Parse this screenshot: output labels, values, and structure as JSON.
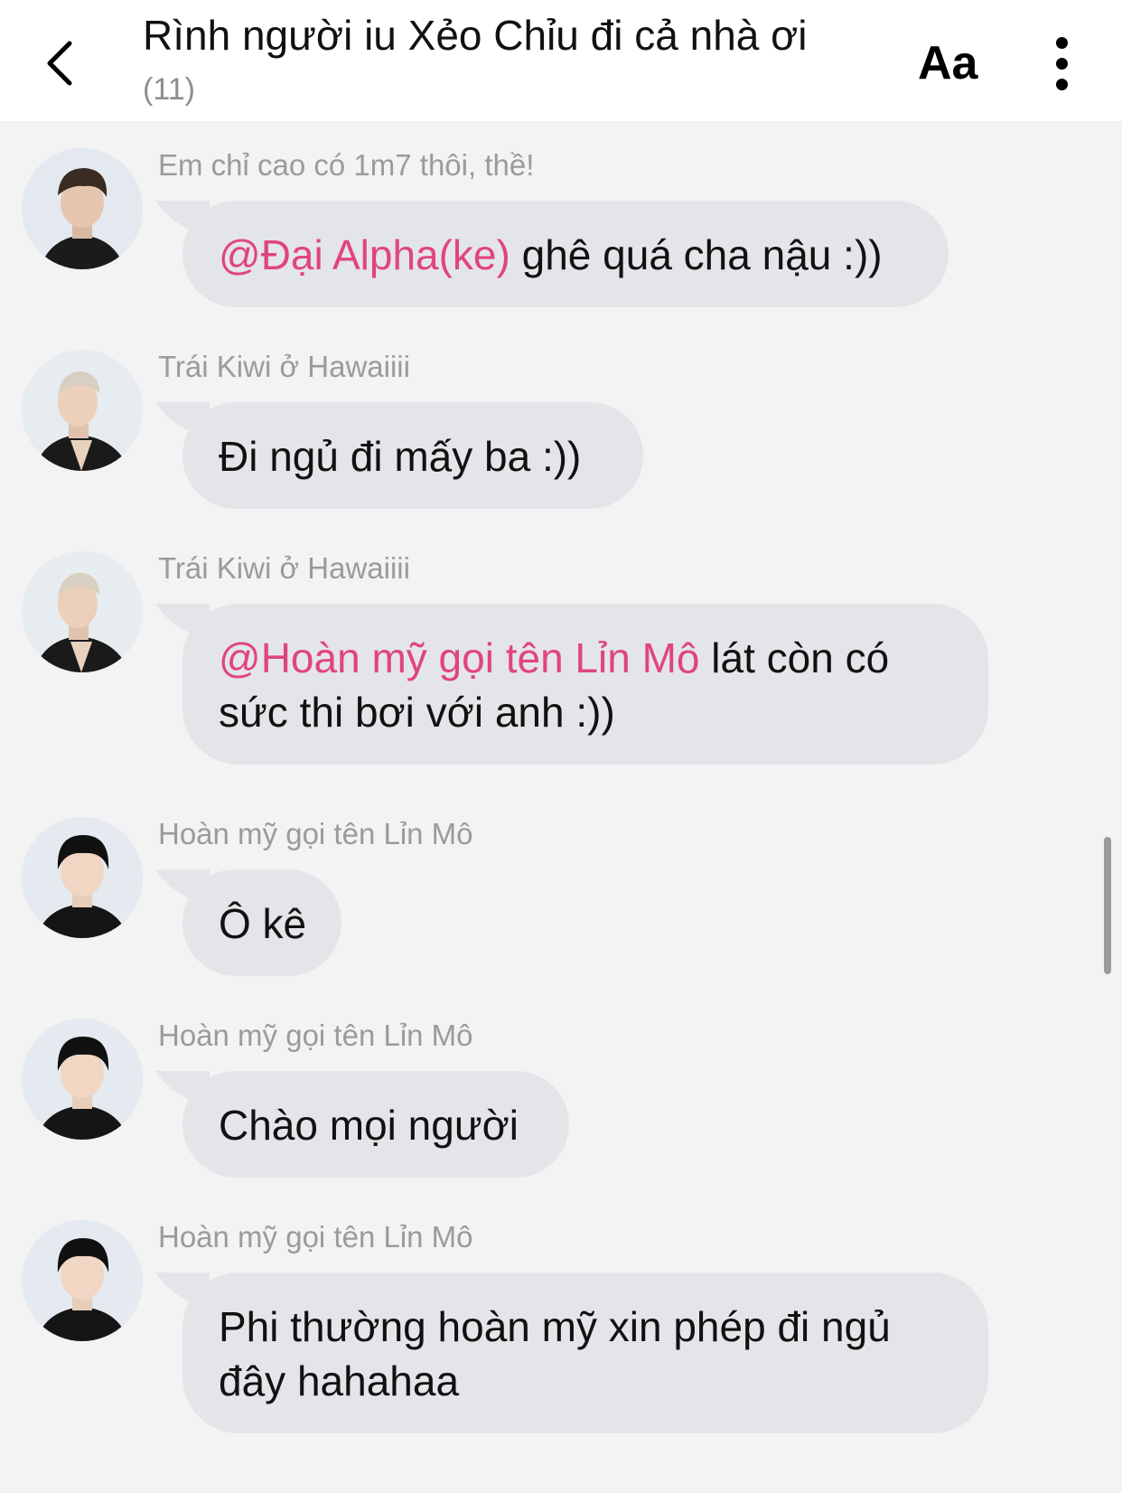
{
  "header": {
    "title": "Rình người iu Xẻo Chỉu đi cả nhà ơi",
    "member_count": "(11)",
    "font_button_label": "Aa",
    "back_icon": "chevron-left-icon",
    "more_icon": "more-vertical-icon"
  },
  "colors": {
    "mention": "#e0457b",
    "bubble": "#e4e5e9",
    "background": "#f3f3f4"
  },
  "messages": [
    {
      "sender": "Em chỉ cao có 1m7 thôi, thề!",
      "mention": "@Đại Alpha(ke)",
      "text": " ghê quá cha nậu :))"
    },
    {
      "sender": "Trái Kiwi ở Hawaiiii",
      "mention": "",
      "text": "Đi ngủ đi mấy ba :))"
    },
    {
      "sender": "Trái Kiwi ở Hawaiiii",
      "mention": "@Hoàn mỹ gọi tên Lỉn Mô",
      "text": " lát còn có sức thi bơi với anh :))"
    },
    {
      "sender": "Hoàn mỹ gọi tên Lỉn Mô",
      "mention": "",
      "text": "Ô kê"
    },
    {
      "sender": "Hoàn mỹ gọi tên Lỉn Mô",
      "mention": "",
      "text": "Chào mọi người"
    },
    {
      "sender": "Hoàn mỹ gọi tên Lỉn Mô",
      "mention": "",
      "text": "Phi thường hoàn mỹ xin phép đi ngủ đây hahahaa"
    }
  ]
}
